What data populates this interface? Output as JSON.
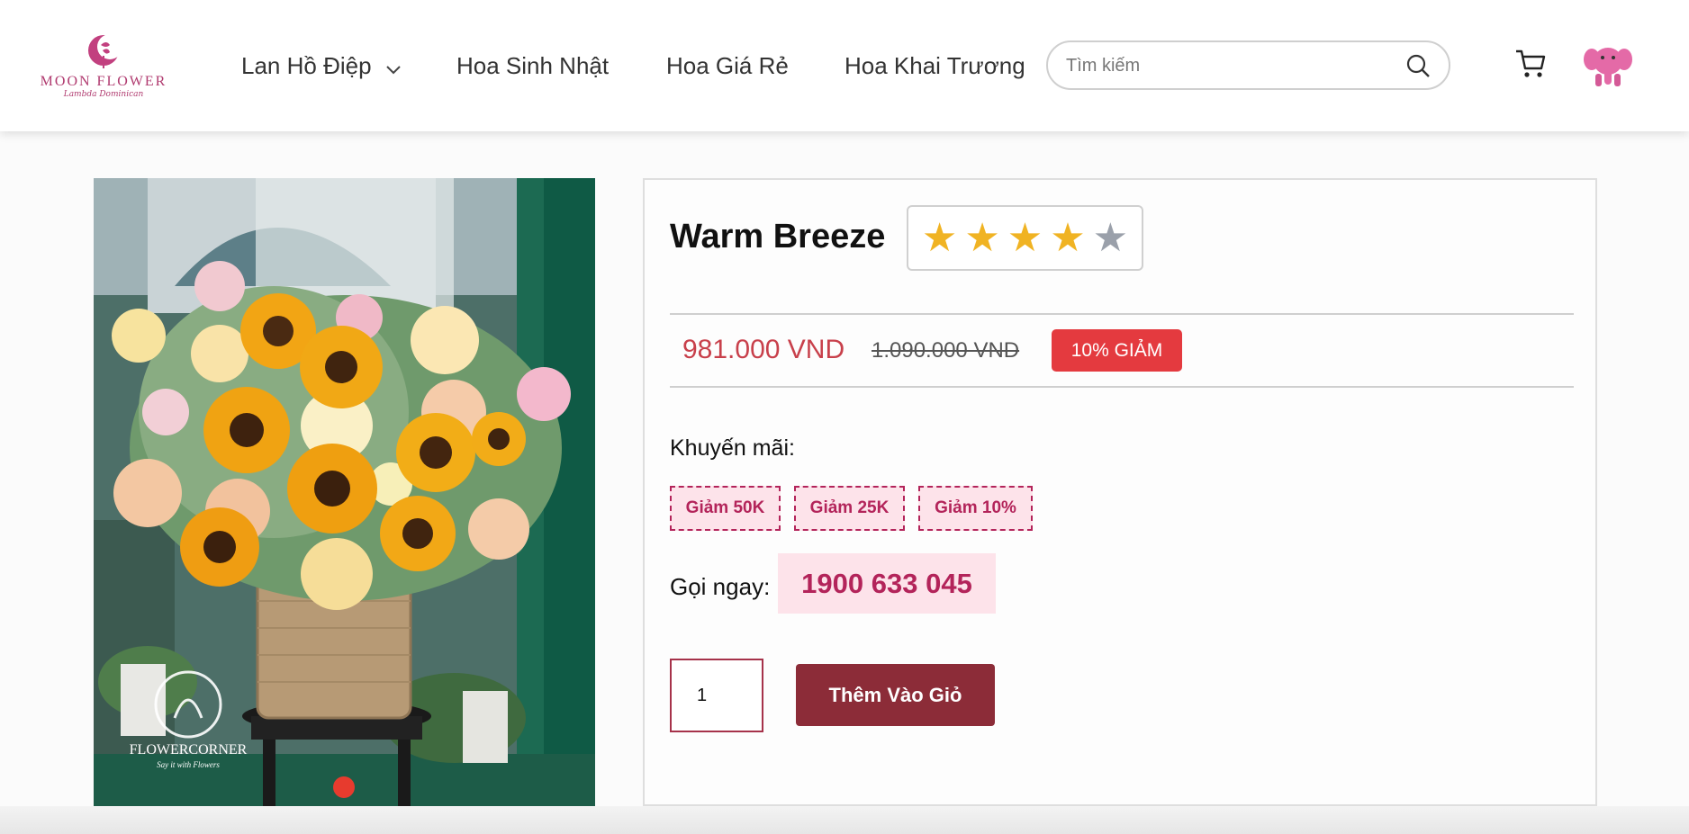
{
  "header": {
    "logo_text": "MOON FLOWER",
    "logo_sub": "Lambda Dominican",
    "nav": [
      {
        "label": "Lan Hồ Điệp",
        "has_dropdown": true
      },
      {
        "label": "Hoa Sinh Nhật"
      },
      {
        "label": "Hoa Giá Rẻ"
      },
      {
        "label": "Hoa Khai Trương"
      }
    ],
    "search": {
      "placeholder": "Tìm kiếm",
      "value": ""
    },
    "icons": {
      "search": "search-icon",
      "cart": "cart-icon",
      "avatar": "avatar-elephant"
    }
  },
  "product": {
    "image_watermark": "FLOWERCORNER",
    "image_watermark_sub": "Say it with Flowers",
    "title": "Warm Breeze",
    "rating": {
      "value": 4,
      "max": 5
    },
    "price": "981.000 VND",
    "old_price": "1.090.000 VND",
    "discount": "10% GIẢM",
    "promo_label": "Khuyến mãi:",
    "coupons": [
      "Giảm 50K",
      "Giảm 25K",
      "Giảm 10%"
    ],
    "call_label": "Gọi ngay:",
    "phone": "1900 633 045",
    "quantity": "1",
    "add_to_cart": "Thêm Vào Giỏ"
  },
  "colors": {
    "brand": "#b03a6f",
    "price": "#c8404b",
    "discount_bg": "#e43a3f",
    "coupon": "#b3245a",
    "coupon_bg": "#fde3ea",
    "button": "#8c2c38",
    "star_on": "#f0b323",
    "star_off": "#9aa0aa"
  }
}
